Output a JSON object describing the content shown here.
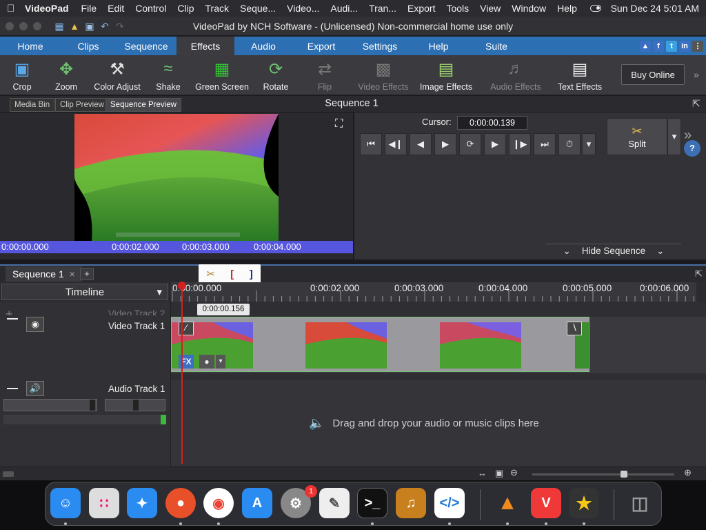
{
  "menubar": {
    "app": "VideoPad",
    "items": [
      "File",
      "Edit",
      "Control",
      "Clip",
      "Track",
      "Seque...",
      "Video...",
      "Audi...",
      "Tran...",
      "Export",
      "Tools",
      "View",
      "Window",
      "Help"
    ],
    "clock": "Sun Dec 24  5:01 AM"
  },
  "window": {
    "title": "VideoPad by NCH Software - (Unlicensed) Non-commercial home use only"
  },
  "ribbon_tabs": [
    "Home",
    "Clips",
    "Sequence",
    "Effects",
    "Audio",
    "Export",
    "Settings",
    "Help",
    "Suite"
  ],
  "active_tab": "Effects",
  "toolbar": {
    "crop": "Crop",
    "zoom": "Zoom",
    "color_adjust": "Color Adjust",
    "shake": "Shake",
    "green_screen": "Green Screen",
    "rotate": "Rotate",
    "flip": "Flip",
    "video_effects": "Video Effects",
    "image_effects": "Image Effects",
    "audio_effects": "Audio Effects",
    "text_effects": "Text Effects",
    "buy_online": "Buy Online"
  },
  "preview_tabs": [
    "Media Bin",
    "Clip Preview",
    "Sequence Preview"
  ],
  "preview_title": "Sequence 1",
  "preview_ruler": [
    "0:00:00.000",
    "0:00:02.000",
    "0:00:03.000",
    "0:00:04.000"
  ],
  "player": {
    "cursor_label": "Cursor:",
    "cursor_value": "0:00:00.139",
    "split_label": "Split",
    "hide_sequence": "Hide Sequence"
  },
  "sequence_tab": "Sequence 1",
  "timeline": {
    "mode": "Timeline",
    "ruler": [
      "0:00:00.000",
      "0:00:02.000",
      "0:00:03.000",
      "0:00:04.000",
      "0:00:05.000",
      "0:00:06.000"
    ],
    "playhead_time": "0:00:00.156",
    "video_track_2": "Video Track 2",
    "video_track_1": "Video Track 1",
    "audio_track_1": "Audio Track 1",
    "audio_drop_hint": "Drag and drop your audio or music clips here",
    "fx_label": "FX"
  },
  "dock": {
    "settings_badge": "1"
  },
  "colors": {
    "accent": "#2d6fb3",
    "playhead": "#d42020",
    "ruler_blue": "#5555dd"
  }
}
